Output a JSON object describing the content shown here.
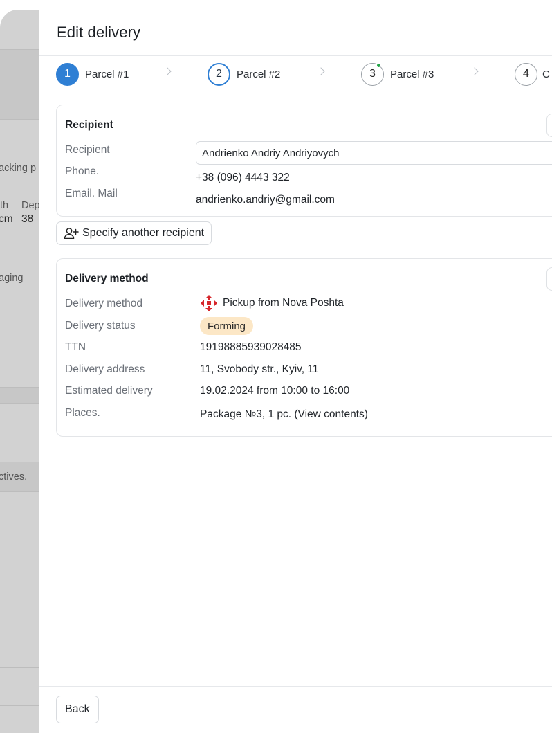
{
  "background": {
    "fragments": [
      "acking p",
      "th",
      "Dep",
      "cm",
      "38",
      "aging",
      "ctives."
    ]
  },
  "drawer": {
    "title": "Edit delivery"
  },
  "stepper": {
    "steps": [
      {
        "number": "1",
        "label": "Parcel #1",
        "state": "active"
      },
      {
        "number": "2",
        "label": "Parcel #2",
        "state": "current"
      },
      {
        "number": "3",
        "label": "Parcel #3",
        "state": "done-dot"
      },
      {
        "number": "4",
        "label": "C",
        "state": "default"
      }
    ]
  },
  "recipient": {
    "title": "Recipient",
    "recipient_label": "Recipient",
    "recipient_value": "Andrienko Andriy Andriyovych",
    "phone_label": "Phone.",
    "phone_value": "+38 (096) 4443 322",
    "email_label": "Email. Mail",
    "email_value": "andrienko.andriy@gmail.com",
    "another_button": "Specify another recipient"
  },
  "delivery": {
    "title": "Delivery method",
    "method_label": "Delivery method",
    "method_value": "Pickup from Nova Poshta",
    "status_label": "Delivery status",
    "status_value": "Forming",
    "ttn_label": "TTN",
    "ttn_value": "19198885939028485",
    "address_label": "Delivery address",
    "address_value": "11, Svobody str., Kyiv, 11",
    "estimated_label": "Estimated delivery",
    "estimated_value": "19.02.2024 from 10:00 to 16:00",
    "places_label": "Places.",
    "places_value": "Package №3, 1 pc. (View contents)"
  },
  "footer": {
    "back_label": "Back"
  },
  "colors": {
    "accent": "#2f7fd4",
    "badge_bg": "#fce7c6",
    "nova_poshta_red": "#d6262b",
    "step_dot": "#22a447"
  }
}
